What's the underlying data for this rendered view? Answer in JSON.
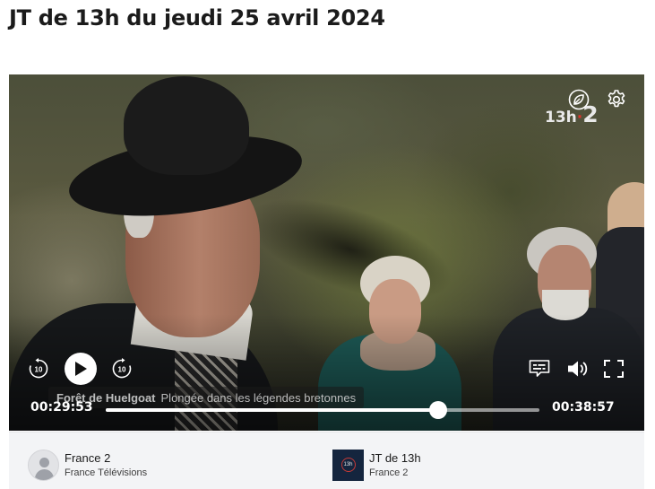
{
  "page": {
    "title": "JT de 13h du jeudi 25 avril 2024"
  },
  "player": {
    "channel_logo": {
      "prefix": "13h",
      "number": "2"
    },
    "icons": {
      "eco": "leaf-icon",
      "settings": "gear-icon",
      "rewind": "rewind-10-icon",
      "play": "play-icon",
      "forward": "forward-10-icon",
      "subtitles": "subtitles-icon",
      "volume": "volume-icon",
      "fullscreen": "fullscreen-icon"
    },
    "skip_seconds": "10",
    "caption": {
      "topic": "Forêt de Huelgoat",
      "subject": "Plongée dans les légendes bretonnes"
    },
    "time_current": "00:29:53",
    "time_total": "00:38:57",
    "progress_fraction": 0.767,
    "accent_color": "#e0322b"
  },
  "info": {
    "channel": {
      "name": "France 2",
      "group": "France Télévisions"
    },
    "program": {
      "name": "JT de 13h",
      "channel": "France 2"
    }
  }
}
